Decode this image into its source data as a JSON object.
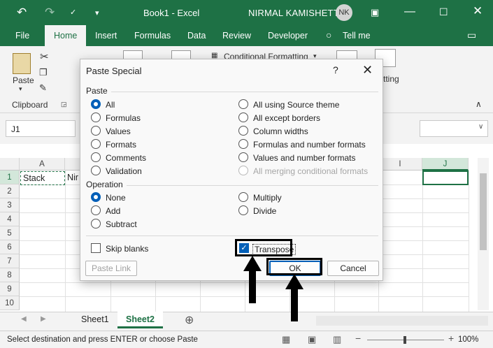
{
  "window": {
    "document_title": "Book1 - Excel",
    "user_name": "NIRMAL KAMISHETTY",
    "user_initials": "NK"
  },
  "ribbon_tabs": [
    {
      "label": "File"
    },
    {
      "label": "Home"
    },
    {
      "label": "Insert"
    },
    {
      "label": "Formulas"
    },
    {
      "label": "Data"
    },
    {
      "label": "Review"
    },
    {
      "label": "Developer"
    },
    {
      "label": "Tell me"
    }
  ],
  "ribbon": {
    "paste_label": "Paste",
    "clipboard_group": "Clipboard",
    "conditional_formatting": "Conditional Formatting",
    "partial_label": "tting"
  },
  "formula_bar": {
    "name_box": "J1"
  },
  "grid": {
    "columns": [
      "A",
      "I",
      "J"
    ],
    "rows": [
      "1",
      "2",
      "3",
      "4",
      "5",
      "6",
      "7",
      "8",
      "9",
      "10"
    ],
    "cell_a1": "Stack",
    "cell_b1": "Nir"
  },
  "sheets": [
    {
      "label": "Sheet1"
    },
    {
      "label": "Sheet2"
    }
  ],
  "status": {
    "message": "Select destination and press ENTER or choose Paste",
    "zoom": "100%"
  },
  "dialog": {
    "title": "Paste Special",
    "help": "?",
    "paste_group": "Paste",
    "paste_options_left": [
      "All",
      "Formulas",
      "Values",
      "Formats",
      "Comments",
      "Validation"
    ],
    "paste_options_right": [
      "All using Source theme",
      "All except borders",
      "Column widths",
      "Formulas and number formats",
      "Values and number formats",
      "All merging conditional formats"
    ],
    "operation_group": "Operation",
    "operation_left": [
      "None",
      "Add",
      "Subtract"
    ],
    "operation_right": [
      "Multiply",
      "Divide"
    ],
    "skip_blanks": "Skip blanks",
    "transpose": "Transpose",
    "paste_link": "Paste Link",
    "ok": "OK",
    "cancel": "Cancel",
    "accent_color": "#005fb8"
  },
  "colors": {
    "excel_green": "#1e7145"
  }
}
